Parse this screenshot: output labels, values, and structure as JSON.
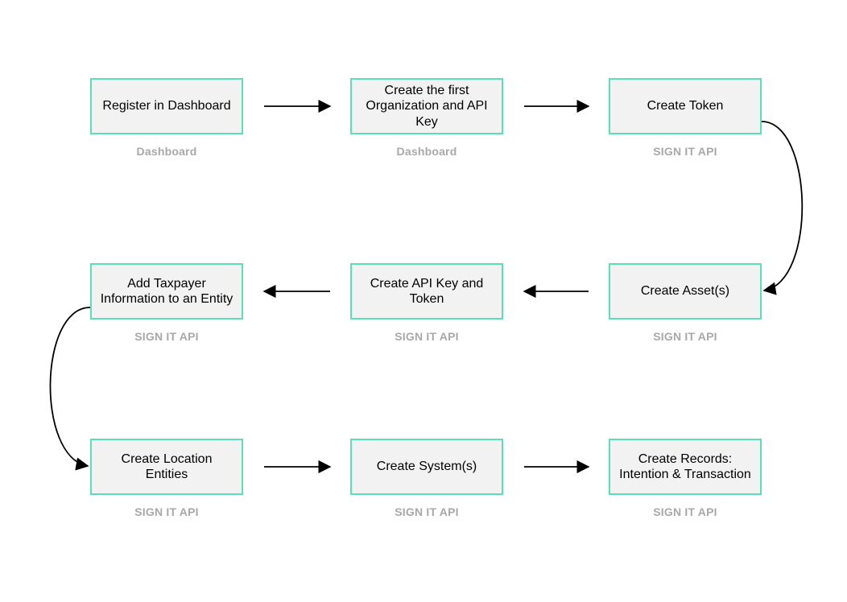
{
  "nodes": {
    "n0": {
      "title": "Register in Dashboard",
      "caption": "Dashboard"
    },
    "n1": {
      "title": "Create the first Organization and API Key",
      "caption": "Dashboard"
    },
    "n2": {
      "title": "Create Token",
      "caption": "SIGN IT API"
    },
    "n3": {
      "title": "Create Asset(s)",
      "caption": "SIGN IT API"
    },
    "n4": {
      "title": "Create API Key and Token",
      "caption": "SIGN IT API"
    },
    "n5": {
      "title": "Add Taxpayer Information to an Entity",
      "caption": "SIGN IT API"
    },
    "n6": {
      "title": "Create Location Entities",
      "caption": "SIGN IT API"
    },
    "n7": {
      "title": "Create System(s)",
      "caption": "SIGN IT API"
    },
    "n8": {
      "title": "Create Records: Intention & Transaction",
      "caption": "SIGN IT API"
    }
  }
}
